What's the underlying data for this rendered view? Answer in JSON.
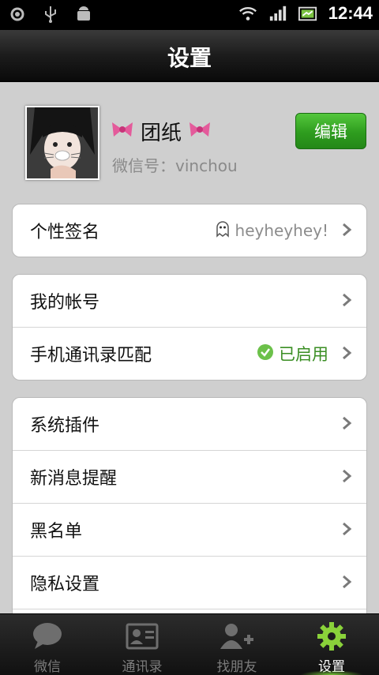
{
  "status_bar": {
    "time": "12:44",
    "left_icons": [
      "settings-notification-icon",
      "usb-icon",
      "android-debug-icon"
    ],
    "right_icons": [
      "wifi-icon",
      "signal-icon",
      "battery-icon"
    ]
  },
  "header": {
    "title": "设置"
  },
  "profile": {
    "nickname": "团纸",
    "wechat_id": "微信号：vinchou",
    "edit_label": "编辑"
  },
  "groups": [
    {
      "rows": [
        {
          "label": "个性签名",
          "value": "heyheyhey!"
        }
      ]
    },
    {
      "rows": [
        {
          "label": "我的帐号"
        },
        {
          "label": "手机通讯录匹配",
          "value": "已启用"
        }
      ]
    },
    {
      "rows": [
        {
          "label": "系统插件"
        },
        {
          "label": "新消息提醒"
        },
        {
          "label": "黑名单"
        },
        {
          "label": "隐私设置"
        }
      ]
    }
  ],
  "tabs": [
    {
      "label": "微信",
      "icon": "chat-icon"
    },
    {
      "label": "通讯录",
      "icon": "contacts-icon"
    },
    {
      "label": "找朋友",
      "icon": "add-friend-icon"
    },
    {
      "label": "设置",
      "icon": "gear-icon",
      "active": true
    }
  ],
  "colors": {
    "accent_green": "#2e9c1e",
    "enabled_green": "#3a8e23"
  }
}
